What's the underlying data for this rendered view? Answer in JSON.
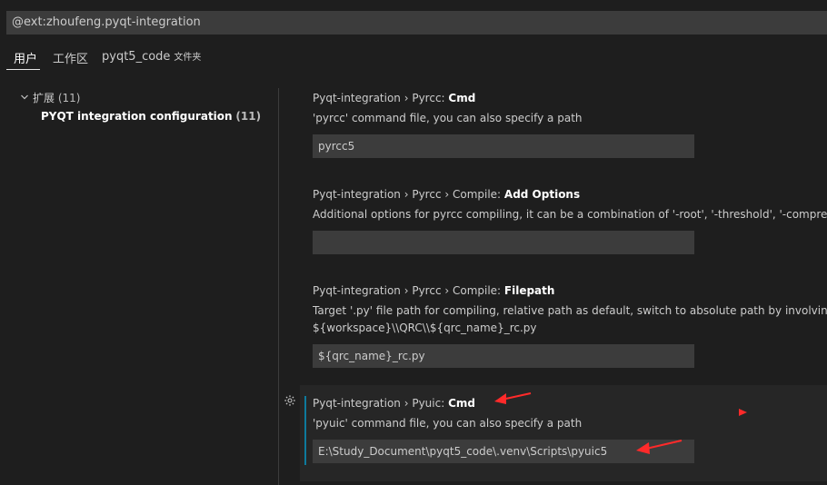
{
  "search": {
    "value": "@ext:zhoufeng.pyqt-integration"
  },
  "tabs": [
    {
      "label": "用户"
    },
    {
      "label": "工作区"
    },
    {
      "label": "pyqt5_code",
      "tag": "文件夹"
    }
  ],
  "tree": {
    "root_label": "扩展",
    "root_count": "(11)",
    "child_label": "PYQT integration configuration",
    "child_count": "(11)"
  },
  "settings": [
    {
      "category": "Pyqt-integration › Pyrcc: ",
      "name": "Cmd",
      "description": "'pyrcc' command file, you can also specify a path",
      "value": "pyrcc5"
    },
    {
      "category": "Pyqt-integration › Pyrcc › Compile: ",
      "name": "Add Options",
      "description": "Additional options for pyrcc compiling, it can be a combination of '-root', '-threshold', '-compress', '-no-compress' and",
      "value": ""
    },
    {
      "category": "Pyqt-integration › Pyrcc › Compile: ",
      "name": "Filepath",
      "description": "Target '.py' file path for compiling, relative path as default, switch to absolute path by involving ${workspace}",
      "description_2": "${workspace}\\\\QRC\\\\${qrc_name}_rc.py",
      "value": "${qrc_name}_rc.py"
    },
    {
      "category": "Pyqt-integration › Pyuic: ",
      "name": "Cmd",
      "description": "'pyuic' command file, you can also specify a path",
      "value": "E:\\Study_Document\\pyqt5_code\\.venv\\Scripts\\pyuic5"
    }
  ],
  "colors": {
    "background": "#1e1e1e",
    "input_background": "#3c3c3c",
    "focus_bar": "#0e7a9d",
    "annotation_arrow": "#ff2a2a"
  },
  "icons": {
    "gear": "gear-icon",
    "chevron": "chevron-down-icon"
  }
}
